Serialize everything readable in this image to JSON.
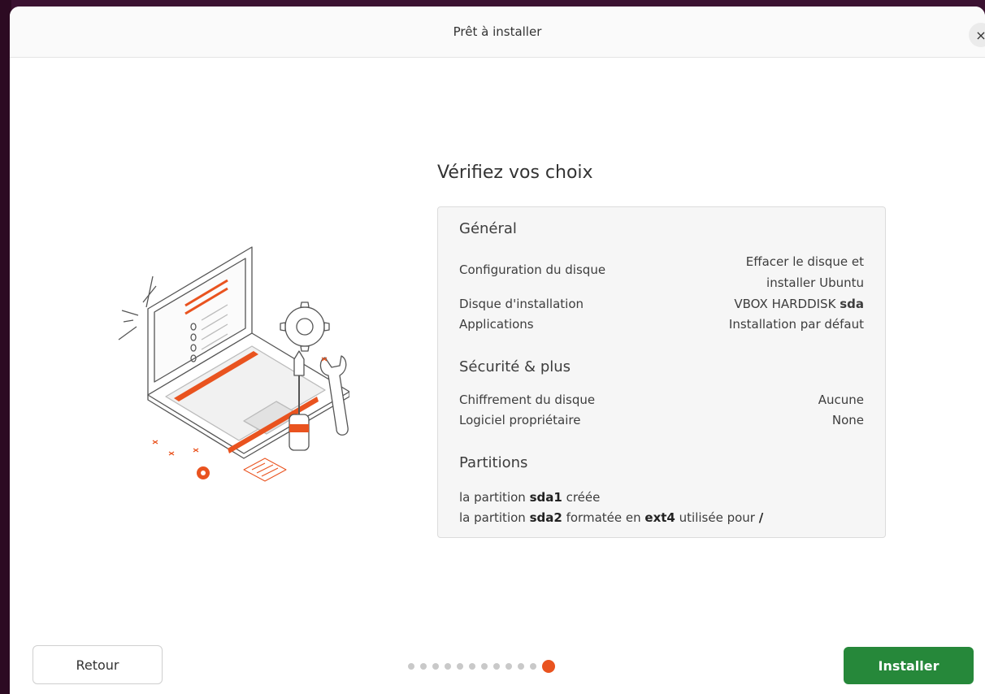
{
  "window": {
    "title": "Prêt à installer",
    "close_glyph": "×"
  },
  "main": {
    "heading": "Vérifiez vos choix",
    "sections": {
      "general": {
        "title": "Général",
        "disk_config_label": "Configuration du disque",
        "disk_config_value_line1": "Effacer le disque et",
        "disk_config_value_line2": "installer Ubuntu",
        "install_disk_label": "Disque d'installation",
        "install_disk_value": "VBOX HARDDISK",
        "install_disk_device": "sda",
        "applications_label": "Applications",
        "applications_value": "Installation par défaut"
      },
      "security": {
        "title": "Sécurité & plus",
        "encryption_label": "Chiffrement du disque",
        "encryption_value": "Aucune",
        "proprietary_label": "Logiciel propriétaire",
        "proprietary_value": "None"
      },
      "partitions": {
        "title": "Partitions",
        "p1_prefix": "la partition",
        "p1_device": "sda1",
        "p1_suffix": "créée",
        "p2_prefix": "la partition",
        "p2_device": "sda2",
        "p2_middle": "formatée en",
        "p2_fs": "ext4",
        "p2_suffix": "utilisée pour",
        "p2_mount": "/"
      }
    }
  },
  "footer": {
    "back_label": "Retour",
    "install_label": "Installer",
    "progress": {
      "total_steps": 12,
      "current_step": 12
    }
  },
  "colors": {
    "accent": "#e9531f",
    "install_button": "#26883a",
    "desktop": "#3b1231"
  },
  "icons": [
    "close-icon",
    "laptop-tools-illustration"
  ]
}
